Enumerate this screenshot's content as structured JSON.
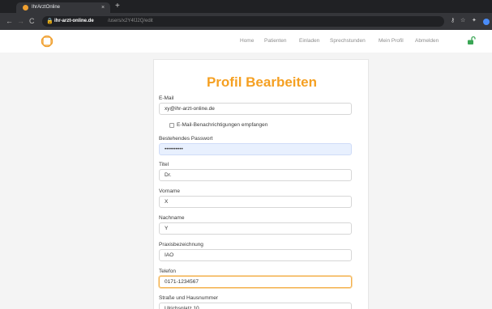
{
  "browser": {
    "tab_title": "IhrArztOnline",
    "tab_close": "×",
    "new_tab": "+",
    "url_host": "ihr-arzt-online.de",
    "url_path": "/users/x2Y4fJ2Q/edit",
    "nav": {
      "back": "←",
      "forward": "→",
      "reload": "C"
    }
  },
  "navbar": {
    "links": [
      "Home",
      "Patienten",
      "Einladen",
      "Sprechstunden",
      "Mein Profil",
      "Abmelden"
    ]
  },
  "form": {
    "title": "Profil Bearbeiten",
    "email": {
      "label": "E-Mail",
      "value": "xy@ihr-arzt-online.de"
    },
    "notifications": {
      "label": "E-Mail-Benachrichtigungen empfangen",
      "checked": false
    },
    "password": {
      "label": "Bestehendes Passwort",
      "value": "••••••••••"
    },
    "title_field": {
      "label": "Titel",
      "value": "Dr."
    },
    "firstname": {
      "label": "Vorname",
      "value": "X"
    },
    "lastname": {
      "label": "Nachname",
      "value": "Y"
    },
    "practice": {
      "label": "Praxisbezeichnung",
      "value": "IAO"
    },
    "phone": {
      "label": "Telefon",
      "value": "0171-1234567"
    },
    "street": {
      "label": "Straße und Hausnummer",
      "value": "Ulrichsplatz 10"
    }
  },
  "colors": {
    "accent": "#f5a022",
    "autofill": "#e8f0fe",
    "focus": "#f5b04a"
  }
}
